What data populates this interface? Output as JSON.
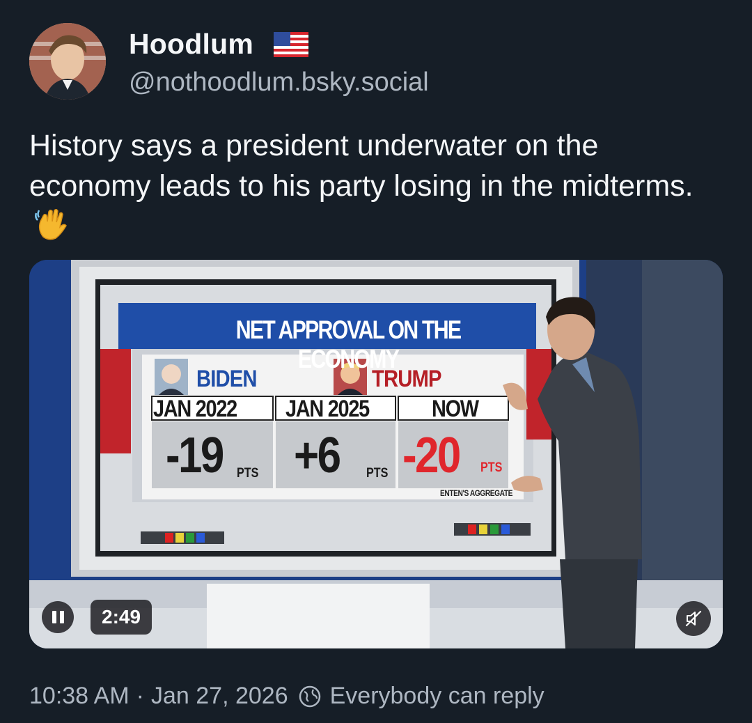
{
  "author": {
    "display_name": "Hoodlum",
    "handle": "@nothoodlum.bsky.social",
    "flag_icon": "us-flag-icon",
    "avatar_icon": "avatar"
  },
  "post": {
    "text": "History says a president underwater on the economy leads to his party losing in the midterms.",
    "emoji_icon": "waving-hand-icon"
  },
  "video": {
    "board_title": "NET APPROVAL ON THE ECONOMY",
    "columns": [
      {
        "name": "BIDEN",
        "date": "JAN 2022",
        "value": "-19",
        "unit": "PTS"
      },
      {
        "name": "TRUMP",
        "date": "JAN 2025",
        "value": "+6",
        "unit": "PTS"
      },
      {
        "name": "",
        "date": "NOW",
        "value": "-20",
        "unit": "PTS"
      }
    ],
    "source": "ENTEN'S AGGREGATE",
    "duration": "2:49",
    "pause_icon": "pause-icon",
    "mute_icon": "muted-speaker-icon",
    "colors": {
      "negative": "#e0262c",
      "positive": "#1a1a1a",
      "title_bar": "#1f4ea8"
    }
  },
  "meta": {
    "time": "10:38 AM",
    "separator": "·",
    "date": "Jan 27, 2026",
    "reply_setting": "Everybody can reply",
    "reply_icon": "globe-icon"
  }
}
